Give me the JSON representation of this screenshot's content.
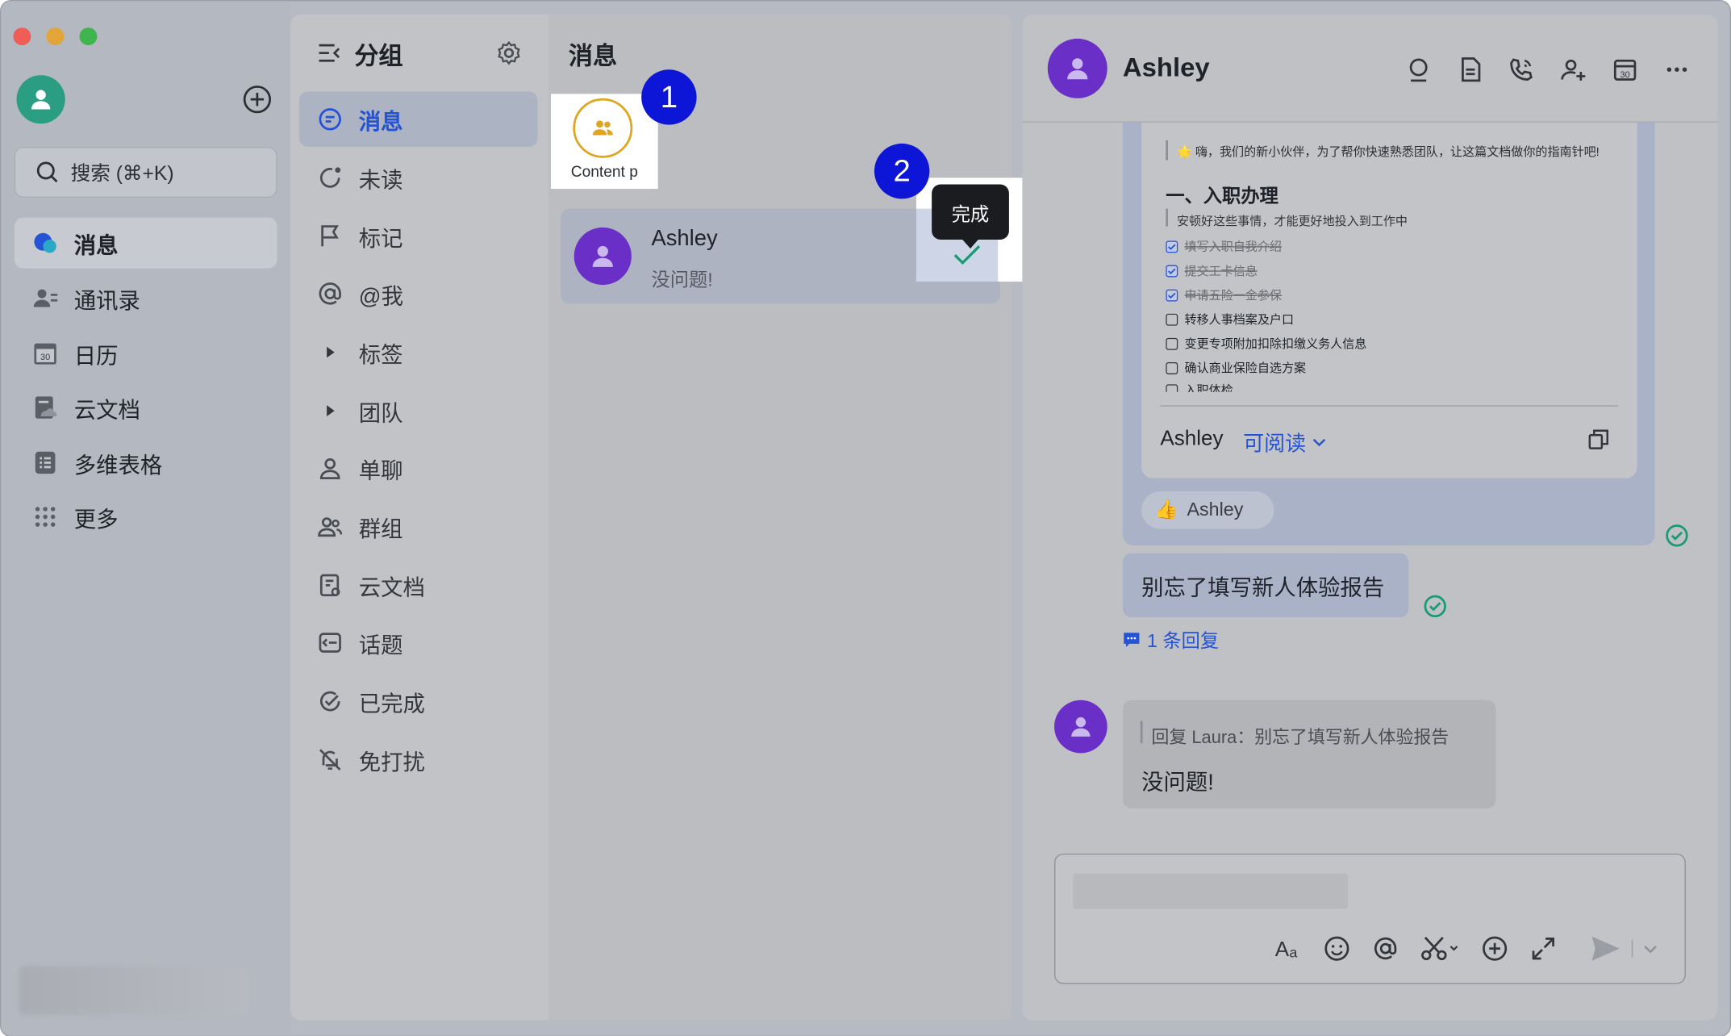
{
  "sidebar": {
    "search_placeholder": "搜索 (⌘+K)",
    "items": [
      {
        "label": "消息",
        "icon": "chat-bubble-icon",
        "active": true
      },
      {
        "label": "通讯录",
        "icon": "contacts-icon"
      },
      {
        "label": "日历",
        "icon": "calendar-icon",
        "icon_text": "30"
      },
      {
        "label": "云文档",
        "icon": "cloud-doc-icon"
      },
      {
        "label": "多维表格",
        "icon": "base-table-icon"
      },
      {
        "label": "更多",
        "icon": "grid-dots-icon"
      }
    ]
  },
  "groups": {
    "title": "分组",
    "items": [
      {
        "label": "消息",
        "icon": "message-icon",
        "active": true
      },
      {
        "label": "未读",
        "icon": "unread-icon"
      },
      {
        "label": "标记",
        "icon": "flag-icon"
      },
      {
        "label": "@我",
        "icon": "at-icon"
      },
      {
        "label": "标签",
        "icon": "caret-right-icon"
      },
      {
        "label": "团队",
        "icon": "caret-right-icon"
      },
      {
        "label": "单聊",
        "icon": "person-icon"
      },
      {
        "label": "群组",
        "icon": "group-icon"
      },
      {
        "label": "云文档",
        "icon": "doc-icon"
      },
      {
        "label": "话题",
        "icon": "topic-icon"
      },
      {
        "label": "已完成",
        "icon": "done-icon"
      },
      {
        "label": "免打扰",
        "icon": "mute-icon"
      }
    ]
  },
  "messages": {
    "title": "消息",
    "feed_shortcut_label": "Content p",
    "callout_1": "1",
    "callout_2": "2",
    "tooltip": "完成",
    "chat_item": {
      "name": "Ashley",
      "preview": "没问题!"
    }
  },
  "chat": {
    "contact_name": "Ashley",
    "doc_card": {
      "intro": "🌟 嗨，我们的新小伙伴，为了帮你快速熟悉团队，让这篇文档做你的指南针吧!",
      "heading": "一、入职办理",
      "subtitle": "安顿好这些事情，才能更好地投入到工作中",
      "checklist": [
        {
          "text": "填写入职自我介绍",
          "done": true
        },
        {
          "text": "提交工卡信息",
          "done": true
        },
        {
          "text": "申请五险一金参保",
          "done": true
        },
        {
          "text": "转移人事档案及户口",
          "done": false
        },
        {
          "text": "变更专项附加扣除扣缴义务人信息",
          "done": false
        },
        {
          "text": "确认商业保险自选方案",
          "done": false
        },
        {
          "text": "入职体检",
          "done": false
        }
      ],
      "owner": "Ashley",
      "permission": "可阅读"
    },
    "reaction": {
      "emoji": "👍",
      "user": "Ashley"
    },
    "sent_message": "别忘了填写新人体验报告",
    "reply_count": "1 条回复",
    "reply_quote": "回复 Laura：别忘了填写新人体验报告",
    "reply_text": "没问题!"
  },
  "colors": {
    "accent": "#2453d6",
    "avatar_purple": "#6a2fc7",
    "avatar_green": "#2a9d82",
    "callout_blue": "#0d16d6",
    "tick_green": "#1a9a74"
  }
}
